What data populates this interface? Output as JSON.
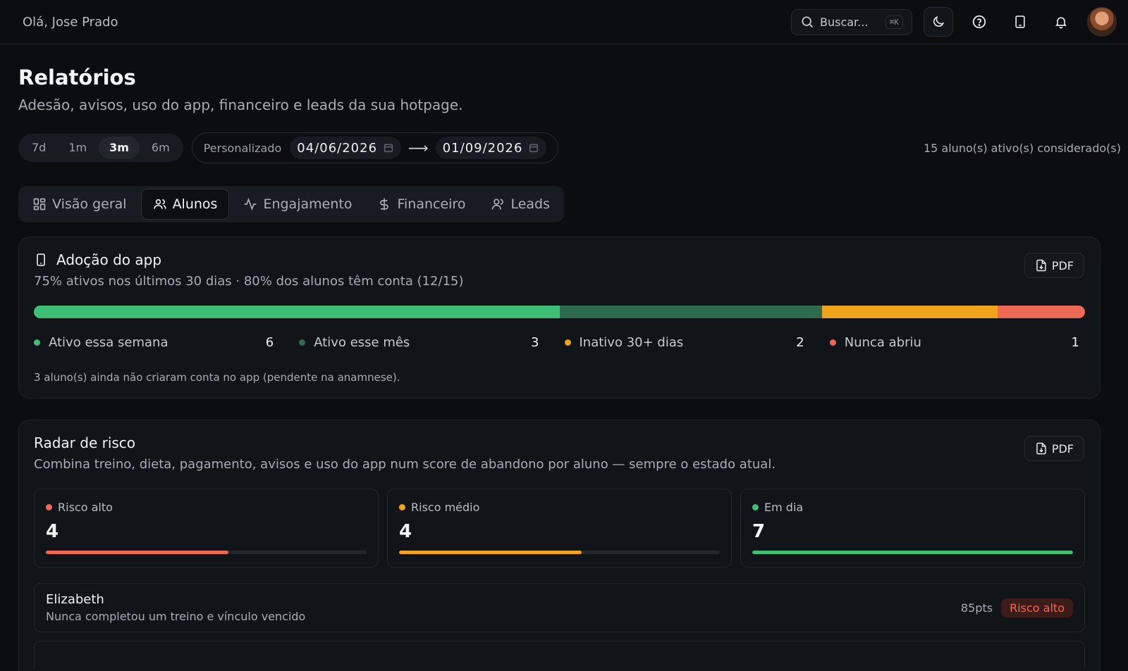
{
  "header": {
    "greeting": "Olá, Jose Prado",
    "search_placeholder": "Buscar...",
    "search_shortcut": "⌘K",
    "icons": [
      "search-icon",
      "moon-icon",
      "help-icon",
      "tablet-icon",
      "bell-icon"
    ]
  },
  "page": {
    "title": "Relatórios",
    "subtitle": "Adesão, avisos, uso do app, financeiro e leads da sua hotpage."
  },
  "filters": {
    "periods": [
      "7d",
      "1m",
      "3m",
      "6m"
    ],
    "selected_period": "3m",
    "custom_label": "Personalizado",
    "date_from": "04/06/2026",
    "date_to": "01/09/2026",
    "arrow": "⟶",
    "active_students": "15 aluno(s) ativo(s) considerado(s)"
  },
  "tabs": [
    {
      "label": "Visão geral",
      "icon": "grid-icon"
    },
    {
      "label": "Alunos",
      "icon": "users-icon",
      "active": true
    },
    {
      "label": "Engajamento",
      "icon": "activity-icon"
    },
    {
      "label": "Financeiro",
      "icon": "dollar-icon"
    },
    {
      "label": "Leads",
      "icon": "user-icon"
    }
  ],
  "adoption": {
    "title": "Adoção do app",
    "pdf_label": "PDF",
    "subtitle": "75% ativos nos últimos 30 dias · 80% dos alunos têm conta (12/15)",
    "segments": [
      {
        "label": "Ativo essa semana",
        "count": "6",
        "value": 6,
        "color": "#3fbf73"
      },
      {
        "label": "Ativo esse mês",
        "count": "3",
        "value": 3,
        "color": "#2d6b4f"
      },
      {
        "label": "Inativo 30+ dias",
        "count": "2",
        "value": 2,
        "color": "#f0a41c"
      },
      {
        "label": "Nunca abriu",
        "count": "1",
        "value": 1,
        "color": "#ef6a55"
      }
    ],
    "note": "3 aluno(s) ainda não criaram conta no app (pendente na anamnese)."
  },
  "risk": {
    "title": "Radar de risco",
    "pdf_label": "PDF",
    "subtitle": "Combina treino, dieta, pagamento, avisos e uso do app num score de abandono por aluno — sempre o estado atual.",
    "boxes": [
      {
        "label": "Risco alto",
        "value": "4",
        "fill_fraction": 0.57,
        "color": "#ef6a55"
      },
      {
        "label": "Risco médio",
        "value": "4",
        "fill_fraction": 0.57,
        "color": "#f0a41c"
      },
      {
        "label": "Em dia",
        "value": "7",
        "fill_fraction": 1.0,
        "color": "#3fbf73"
      }
    ],
    "students": [
      {
        "name": "Elizabeth",
        "reason": "Nunca completou um treino e vínculo vencido",
        "points": "85pts",
        "badge": "Risco alto"
      }
    ]
  }
}
